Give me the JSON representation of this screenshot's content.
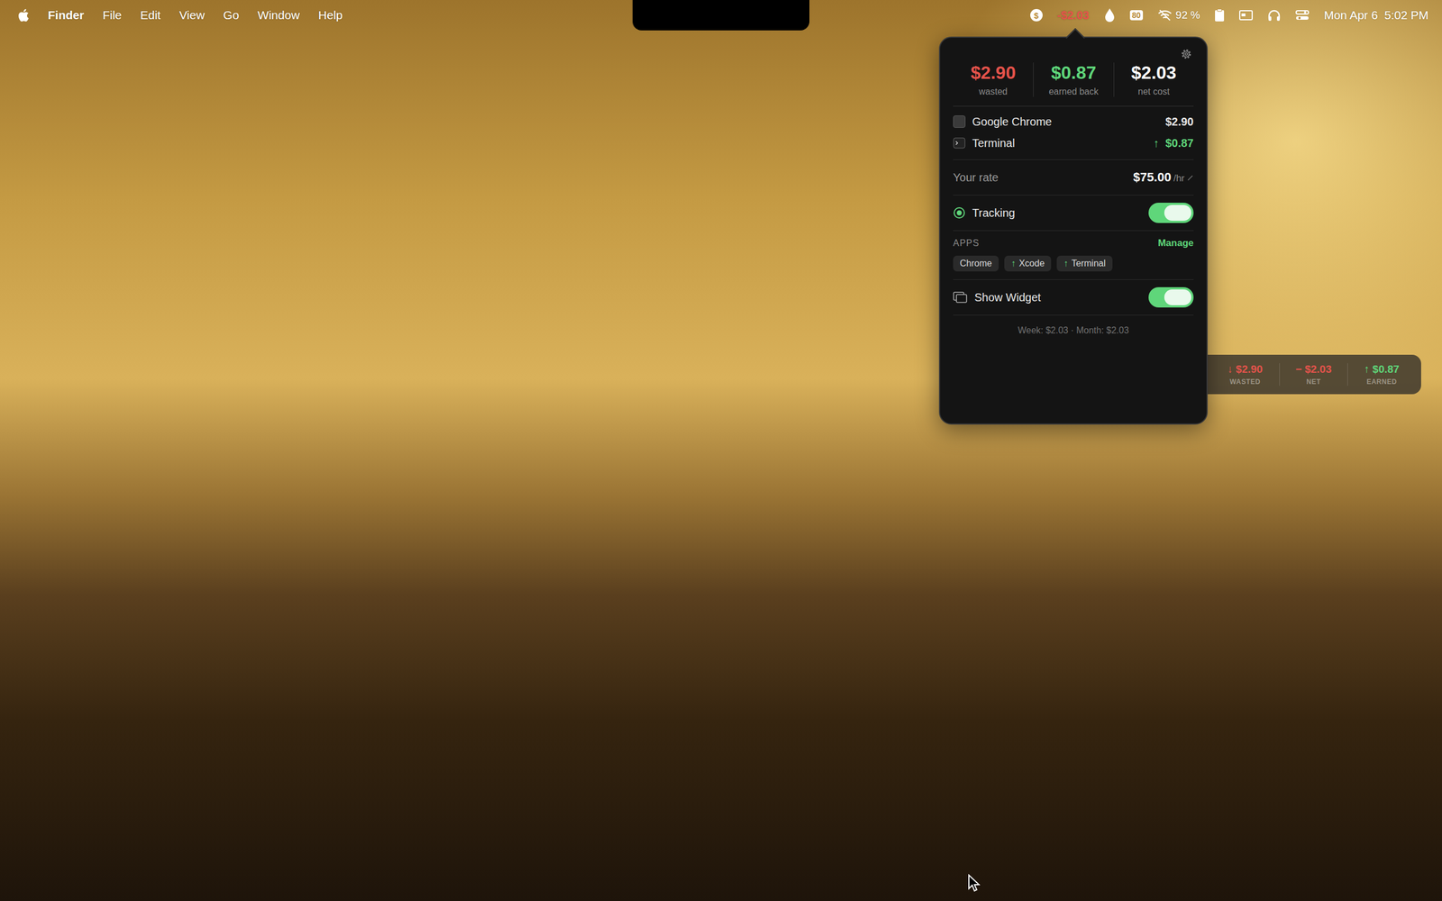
{
  "menu_bar": {
    "app": "Finder",
    "menus": [
      "File",
      "Edit",
      "View",
      "Go",
      "Window",
      "Help"
    ],
    "status_icon": "$",
    "status_amount": "-$2.03",
    "battery_badge": "80",
    "wifi_percent": "92 %",
    "clock": "Mon Apr 6  5:02 PM"
  },
  "popover": {
    "summary": [
      {
        "value": "$2.90",
        "label": "wasted",
        "color": "#e5534b"
      },
      {
        "value": "$0.87",
        "label": "earned back",
        "color": "#5fd67a"
      },
      {
        "value": "$2.03",
        "label": "net cost",
        "color": "#ffffff"
      }
    ],
    "apps": [
      {
        "name": "Google Chrome",
        "amount": "$2.90",
        "earning": false,
        "arrow": ""
      },
      {
        "name": "Terminal",
        "amount": "$0.87",
        "earning": true,
        "arrow": "↑"
      }
    ],
    "rate": {
      "label": "Your rate",
      "value": "$75.00",
      "unit": "/hr"
    },
    "tracking": {
      "label": "Tracking",
      "on": true
    },
    "apps_section": {
      "label": "APPS",
      "action": "Manage",
      "chips": [
        {
          "label": "Chrome",
          "earning": false,
          "arrow": ""
        },
        {
          "label": "Xcode",
          "earning": true,
          "arrow": "↑"
        },
        {
          "label": "Terminal",
          "earning": true,
          "arrow": "↑"
        }
      ]
    },
    "widget_toggle": {
      "label": "Show Widget",
      "on": true
    },
    "footer": "Week: $2.03 · Month: $2.03"
  },
  "widget": {
    "stats": [
      {
        "arrow": "↓",
        "value": "$2.90",
        "label": "WASTED",
        "color": "#e5534b"
      },
      {
        "arrow": "−",
        "value": "$2.03",
        "label": "NET",
        "color": "#e5534b"
      },
      {
        "arrow": "↑",
        "value": "$0.87",
        "label": "EARNED",
        "color": "#5fd67a"
      }
    ]
  }
}
